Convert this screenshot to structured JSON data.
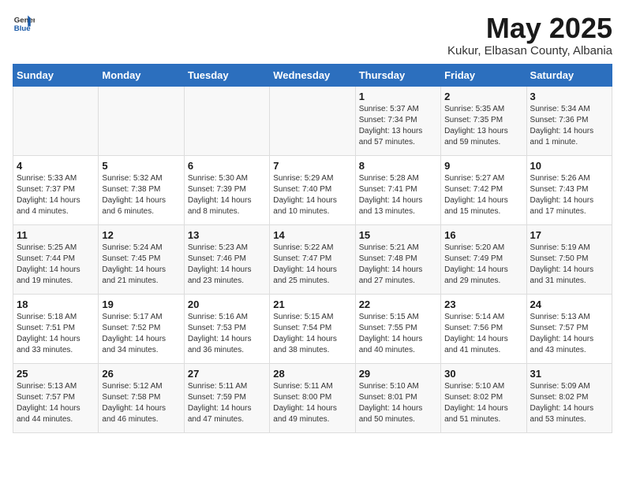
{
  "header": {
    "logo_general": "General",
    "logo_blue": "Blue",
    "title": "May 2025",
    "subtitle": "Kukur, Elbasan County, Albania"
  },
  "weekdays": [
    "Sunday",
    "Monday",
    "Tuesday",
    "Wednesday",
    "Thursday",
    "Friday",
    "Saturday"
  ],
  "weeks": [
    [
      {
        "day": "",
        "info": ""
      },
      {
        "day": "",
        "info": ""
      },
      {
        "day": "",
        "info": ""
      },
      {
        "day": "",
        "info": ""
      },
      {
        "day": "1",
        "info": "Sunrise: 5:37 AM\nSunset: 7:34 PM\nDaylight: 13 hours\nand 57 minutes."
      },
      {
        "day": "2",
        "info": "Sunrise: 5:35 AM\nSunset: 7:35 PM\nDaylight: 13 hours\nand 59 minutes."
      },
      {
        "day": "3",
        "info": "Sunrise: 5:34 AM\nSunset: 7:36 PM\nDaylight: 14 hours\nand 1 minute."
      }
    ],
    [
      {
        "day": "4",
        "info": "Sunrise: 5:33 AM\nSunset: 7:37 PM\nDaylight: 14 hours\nand 4 minutes."
      },
      {
        "day": "5",
        "info": "Sunrise: 5:32 AM\nSunset: 7:38 PM\nDaylight: 14 hours\nand 6 minutes."
      },
      {
        "day": "6",
        "info": "Sunrise: 5:30 AM\nSunset: 7:39 PM\nDaylight: 14 hours\nand 8 minutes."
      },
      {
        "day": "7",
        "info": "Sunrise: 5:29 AM\nSunset: 7:40 PM\nDaylight: 14 hours\nand 10 minutes."
      },
      {
        "day": "8",
        "info": "Sunrise: 5:28 AM\nSunset: 7:41 PM\nDaylight: 14 hours\nand 13 minutes."
      },
      {
        "day": "9",
        "info": "Sunrise: 5:27 AM\nSunset: 7:42 PM\nDaylight: 14 hours\nand 15 minutes."
      },
      {
        "day": "10",
        "info": "Sunrise: 5:26 AM\nSunset: 7:43 PM\nDaylight: 14 hours\nand 17 minutes."
      }
    ],
    [
      {
        "day": "11",
        "info": "Sunrise: 5:25 AM\nSunset: 7:44 PM\nDaylight: 14 hours\nand 19 minutes."
      },
      {
        "day": "12",
        "info": "Sunrise: 5:24 AM\nSunset: 7:45 PM\nDaylight: 14 hours\nand 21 minutes."
      },
      {
        "day": "13",
        "info": "Sunrise: 5:23 AM\nSunset: 7:46 PM\nDaylight: 14 hours\nand 23 minutes."
      },
      {
        "day": "14",
        "info": "Sunrise: 5:22 AM\nSunset: 7:47 PM\nDaylight: 14 hours\nand 25 minutes."
      },
      {
        "day": "15",
        "info": "Sunrise: 5:21 AM\nSunset: 7:48 PM\nDaylight: 14 hours\nand 27 minutes."
      },
      {
        "day": "16",
        "info": "Sunrise: 5:20 AM\nSunset: 7:49 PM\nDaylight: 14 hours\nand 29 minutes."
      },
      {
        "day": "17",
        "info": "Sunrise: 5:19 AM\nSunset: 7:50 PM\nDaylight: 14 hours\nand 31 minutes."
      }
    ],
    [
      {
        "day": "18",
        "info": "Sunrise: 5:18 AM\nSunset: 7:51 PM\nDaylight: 14 hours\nand 33 minutes."
      },
      {
        "day": "19",
        "info": "Sunrise: 5:17 AM\nSunset: 7:52 PM\nDaylight: 14 hours\nand 34 minutes."
      },
      {
        "day": "20",
        "info": "Sunrise: 5:16 AM\nSunset: 7:53 PM\nDaylight: 14 hours\nand 36 minutes."
      },
      {
        "day": "21",
        "info": "Sunrise: 5:15 AM\nSunset: 7:54 PM\nDaylight: 14 hours\nand 38 minutes."
      },
      {
        "day": "22",
        "info": "Sunrise: 5:15 AM\nSunset: 7:55 PM\nDaylight: 14 hours\nand 40 minutes."
      },
      {
        "day": "23",
        "info": "Sunrise: 5:14 AM\nSunset: 7:56 PM\nDaylight: 14 hours\nand 41 minutes."
      },
      {
        "day": "24",
        "info": "Sunrise: 5:13 AM\nSunset: 7:57 PM\nDaylight: 14 hours\nand 43 minutes."
      }
    ],
    [
      {
        "day": "25",
        "info": "Sunrise: 5:13 AM\nSunset: 7:57 PM\nDaylight: 14 hours\nand 44 minutes."
      },
      {
        "day": "26",
        "info": "Sunrise: 5:12 AM\nSunset: 7:58 PM\nDaylight: 14 hours\nand 46 minutes."
      },
      {
        "day": "27",
        "info": "Sunrise: 5:11 AM\nSunset: 7:59 PM\nDaylight: 14 hours\nand 47 minutes."
      },
      {
        "day": "28",
        "info": "Sunrise: 5:11 AM\nSunset: 8:00 PM\nDaylight: 14 hours\nand 49 minutes."
      },
      {
        "day": "29",
        "info": "Sunrise: 5:10 AM\nSunset: 8:01 PM\nDaylight: 14 hours\nand 50 minutes."
      },
      {
        "day": "30",
        "info": "Sunrise: 5:10 AM\nSunset: 8:02 PM\nDaylight: 14 hours\nand 51 minutes."
      },
      {
        "day": "31",
        "info": "Sunrise: 5:09 AM\nSunset: 8:02 PM\nDaylight: 14 hours\nand 53 minutes."
      }
    ]
  ]
}
